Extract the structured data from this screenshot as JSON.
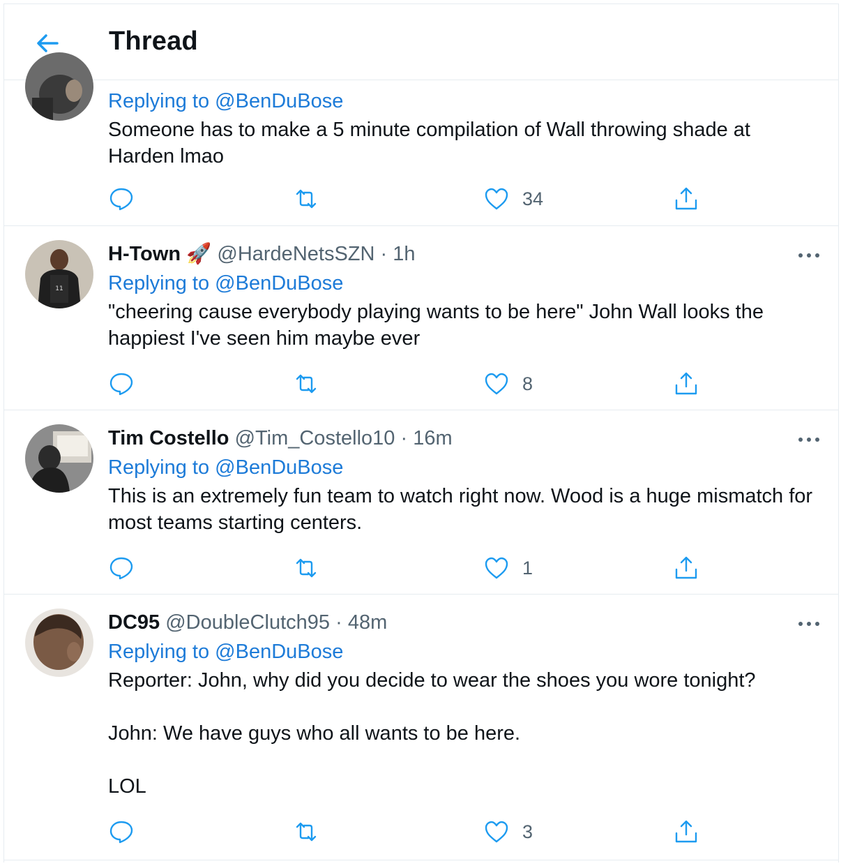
{
  "header": {
    "title": "Thread"
  },
  "tweets": [
    {
      "name": "",
      "emoji": "",
      "handle": "",
      "time": "",
      "replying_prefix": "Replying to",
      "replying_to": "@BenDuBose",
      "text": "Someone has to make a 5 minute compilation of Wall throwing shade at Harden lmao",
      "likes": "34"
    },
    {
      "name": "H-Town",
      "emoji": "🚀",
      "handle": "@HardeNetsSZN",
      "time": "1h",
      "replying_prefix": "Replying to",
      "replying_to": "@BenDuBose",
      "text": "\"cheering cause everybody playing wants to be here\" John Wall looks the happiest I've seen him maybe ever",
      "likes": "8"
    },
    {
      "name": "Tim Costello",
      "emoji": "",
      "handle": "@Tim_Costello10",
      "time": "16m",
      "replying_prefix": "Replying to",
      "replying_to": "@BenDuBose",
      "text": "This is an extremely fun team to watch right now. Wood is a huge mismatch for most teams starting centers.",
      "likes": "1"
    },
    {
      "name": "DC95",
      "emoji": "",
      "handle": "@DoubleClutch95",
      "time": "48m",
      "replying_prefix": "Replying to",
      "replying_to": "@BenDuBose",
      "text": "Reporter: John, why did you decide to wear the shoes you wore tonight?\n\nJohn: We have guys who all wants to be here.\n\nLOL",
      "likes": "3"
    }
  ],
  "meta_separator": "·",
  "icons": {
    "back": "arrow-left-icon",
    "reply": "speech-bubble-icon",
    "retweet": "retweet-icon",
    "like": "heart-icon",
    "share": "share-icon",
    "more": "ellipsis-icon"
  },
  "colors": {
    "accent": "#1d9bf0",
    "link": "#1d7bd8",
    "secondary": "#536471",
    "divider": "#e6ecf0"
  }
}
